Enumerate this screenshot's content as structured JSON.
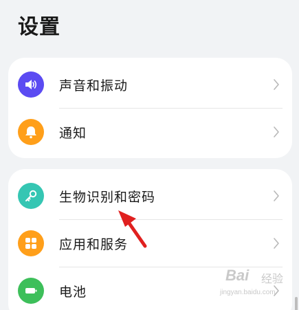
{
  "header": {
    "title": "设置"
  },
  "groups": [
    {
      "items": [
        {
          "label": "声音和振动",
          "icon": "volume-icon",
          "color": "#5b4bf2"
        },
        {
          "label": "通知",
          "icon": "bell-icon",
          "color": "#ff9f1a"
        }
      ]
    },
    {
      "items": [
        {
          "label": "生物识别和密码",
          "icon": "key-icon",
          "color": "#35c6b3"
        },
        {
          "label": "应用和服务",
          "icon": "apps-grid-icon",
          "color": "#ff9f1a"
        },
        {
          "label": "电池",
          "icon": "battery-icon",
          "color": "#3dbf5a"
        }
      ]
    }
  ],
  "watermark": {
    "brand": "Bai",
    "brand2": "经验",
    "url": "jingyan.baidu.com"
  },
  "annotation": {
    "color": "#e0201f"
  }
}
